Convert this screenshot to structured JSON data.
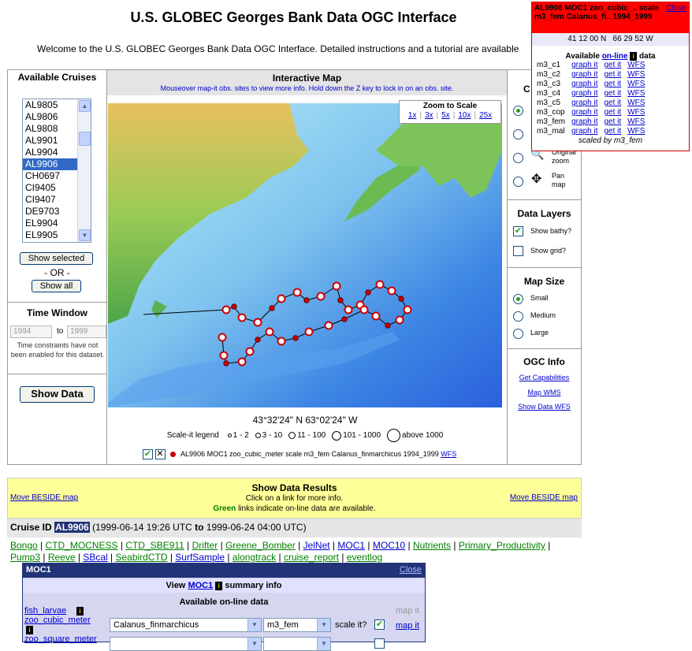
{
  "header": {
    "title": "U.S. GLOBEC Georges Bank Data OGC Interface",
    "welcome": "Welcome to the U.S. GLOBEC Georges Bank Data OGC Interface. Detailed instructions and a tutorial are available"
  },
  "left": {
    "cruises_title": "Available Cruises",
    "cruises": [
      "AL9805",
      "AL9806",
      "AL9808",
      "AL9901",
      "AL9904",
      "AL9906",
      "CH0697",
      "CI9405",
      "CI9407",
      "DE9703",
      "EL9904",
      "EL9905"
    ],
    "selected_cruise": "AL9906",
    "show_selected": "Show selected",
    "or_label": "- OR -",
    "show_all": "Show all",
    "time_title": "Time Window",
    "year_from": "1994",
    "to_label": "to",
    "year_to": "1999",
    "time_note": "Time constraints have not been enabled for this dataset.",
    "show_data": "Show Data"
  },
  "map": {
    "title": "Interactive Map",
    "hint": "Mouseover map-it obs. sites to view more info. Hold down the Z key to lock in on an obs. site.",
    "zoom_title": "Zoom to Scale",
    "zoom_options": [
      "1x",
      "3x",
      "5x",
      "10x",
      "25x"
    ],
    "coords": "43°32'24\" N 63°02'24\" W",
    "legend_label": "Scale-it legend",
    "legend_items": [
      "1 - 2",
      "3 - 10",
      "11 - 100",
      "101 - 1000",
      "above 1000"
    ],
    "layer_text": "AL9906 MOC1 zoo_cubic_meter scale m3_fem Calanus_finmarchicus 1994_1999",
    "layer_link": "WFS"
  },
  "right": {
    "c_label": "C",
    "original_zoom": "Original zoom",
    "pan_map": "Pan map",
    "data_layers_title": "Data Layers",
    "show_bathy": "Show bathy?",
    "show_grid": "Show grid?",
    "map_size_title": "Map Size",
    "sizes": [
      "Small",
      "Medium",
      "Large"
    ],
    "ogc_title": "OGC Info",
    "ogc_links": [
      "Get Capabilities",
      "Map WMS",
      "Show Data WFS"
    ]
  },
  "popup": {
    "title": "AL9906 MOC1 zoo_cubic_.. scale m3_fem Calanus_fi.. 1994_1999",
    "close": "Close",
    "coords": "41 12 00 N   66 29 52 W",
    "available_prefix": "Available",
    "available_link": "on-line",
    "available_suffix": "data",
    "rows": [
      {
        "name": "m3_c1",
        "graph": "graph it",
        "get": "get it",
        "wfs": "WFS"
      },
      {
        "name": "m3_c2",
        "graph": "graph it",
        "get": "get it",
        "wfs": "WFS"
      },
      {
        "name": "m3_c3",
        "graph": "graph it",
        "get": "get it",
        "wfs": "WFS"
      },
      {
        "name": "m3_c4",
        "graph": "graph it",
        "get": "get it",
        "wfs": "WFS"
      },
      {
        "name": "m3_c5",
        "graph": "graph it",
        "get": "get it",
        "wfs": "WFS"
      },
      {
        "name": "m3_cop",
        "graph": "graph it",
        "get": "get it",
        "wfs": "WFS"
      },
      {
        "name": "m3_fem",
        "graph": "graph it",
        "get": "get it",
        "wfs": "WFS"
      },
      {
        "name": "m3_mal",
        "graph": "graph it",
        "get": "get it",
        "wfs": "WFS"
      }
    ],
    "scaled_by": "scaled by m3_fem"
  },
  "results": {
    "move_left": "Move BESIDE map",
    "move_right": "Move BESIDE map",
    "title": "Show Data Results",
    "line1": "Click on a link for more info.",
    "green_word": "Green",
    "line2": "links indicate on-line data are available.",
    "cruise_label": "Cruise ID",
    "cruise_id": "AL9906",
    "start": "(1999-06-14  19:26 UTC",
    "to": "to",
    "end": "1999-06-24  04:00 UTC)",
    "data_links": [
      {
        "label": "Bongo",
        "green": true
      },
      {
        "label": "CTD_MOCNESS",
        "green": true
      },
      {
        "label": "CTD_SBE911",
        "green": true
      },
      {
        "label": "Drifter",
        "green": true
      },
      {
        "label": "Greene_Bomber",
        "green": true
      },
      {
        "label": "JelNet",
        "green": false
      },
      {
        "label": "MOC1",
        "green": false
      },
      {
        "label": "MOC10",
        "green": false
      },
      {
        "label": "Nutrients",
        "green": true
      },
      {
        "label": "Primary_Productivity",
        "green": true
      },
      {
        "label": "Pump3",
        "green": true
      },
      {
        "label": "Reeve",
        "green": true
      },
      {
        "label": "SBcal",
        "green": false
      },
      {
        "label": "SeabirdCTD",
        "green": true
      },
      {
        "label": "SurfSample",
        "green": false
      },
      {
        "label": "alongtrack",
        "green": true
      },
      {
        "label": "cruise_report",
        "green": true
      },
      {
        "label": "eventlog",
        "green": true
      }
    ]
  },
  "moc": {
    "title": "MOC1",
    "close": "Close",
    "view_prefix": "View",
    "view_link": "MOC1",
    "view_suffix": "summary info",
    "available": "Available on-line data",
    "rows": [
      {
        "name": "fish_larvae",
        "map": "map it"
      },
      {
        "name": "zoo_cubic_meter",
        "species": "Calanus_finmarchicus",
        "scale": "m3_fem",
        "scale_label": "scale it?",
        "map": "map it"
      },
      {
        "name": "zoo_square_meter"
      }
    ]
  },
  "colors": {
    "accent": "#0000cc",
    "green_link": "#008000",
    "popup_red": "#ff0000",
    "results_bg": "#ffff99",
    "moc_header": "#223377"
  }
}
